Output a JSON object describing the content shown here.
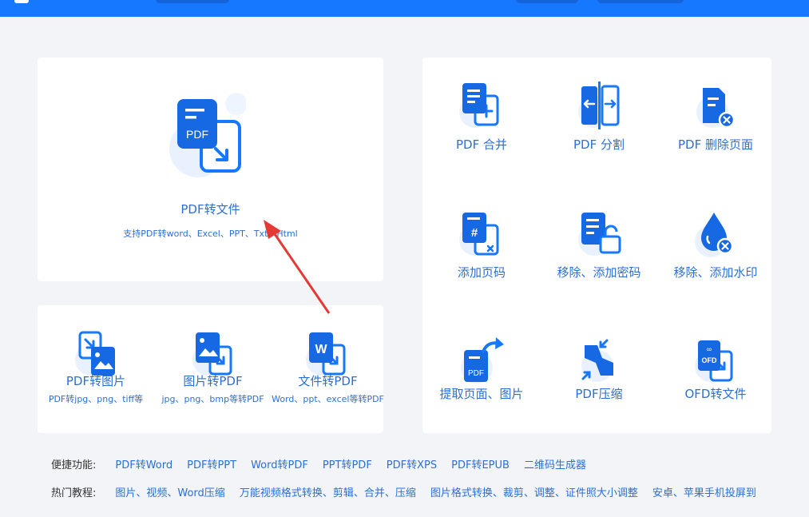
{
  "main_tool": {
    "label": "PDF转文件",
    "subtitle": "支持PDF转word、Excel、PPT、Txt、Html",
    "icon_text": "PDF"
  },
  "lower_tools": [
    {
      "label": "PDF转图片",
      "subtitle": "PDF转jpg、png、tiff等",
      "icon": "image-convert-icon"
    },
    {
      "label": "图片转PDF",
      "subtitle": "jpg、png、bmp等转PDF",
      "icon": "image-to-pdf-icon"
    },
    {
      "label": "文件转PDF",
      "subtitle": "Word、ppt、excel等转PDF",
      "icon": "word-to-pdf-icon"
    }
  ],
  "grid_tools": [
    {
      "label": "PDF 合并",
      "icon": "merge-icon"
    },
    {
      "label": "PDF 分割",
      "icon": "split-icon"
    },
    {
      "label": "PDF 删除页面",
      "icon": "delete-page-icon"
    },
    {
      "label": "添加页码",
      "icon": "page-number-icon"
    },
    {
      "label": "移除、添加密码",
      "icon": "password-icon"
    },
    {
      "label": "移除、添加水印",
      "icon": "watermark-icon"
    },
    {
      "label": "提取页面、图片",
      "icon": "extract-icon",
      "icon_text": "PDF"
    },
    {
      "label": "PDF压缩",
      "icon": "compress-icon"
    },
    {
      "label": "OFD转文件",
      "icon": "ofd-icon",
      "icon_text": "OFD"
    }
  ],
  "shortcuts": {
    "heading": "便捷功能:",
    "links": [
      "PDF转Word",
      "PDF转PPT",
      "Word转PDF",
      "PPT转PDF",
      "PDF转XPS",
      "PDF转EPUB",
      "二维码生成器"
    ]
  },
  "tutorials": {
    "heading": "热门教程:",
    "links": [
      "图片、视频、Word压缩",
      "万能视频格式转换、剪辑、合并、压缩",
      "图片格式转换、裁剪、调整、证件照大小调整",
      "安卓、苹果手机投屏到"
    ]
  },
  "colors": {
    "accent": "#1677ff",
    "link": "#2b6fd6",
    "annotation_arrow": "#e53935"
  }
}
